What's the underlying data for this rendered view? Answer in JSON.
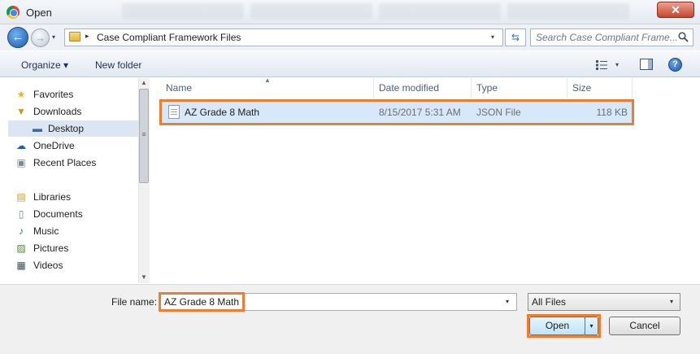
{
  "window": {
    "title": "Open",
    "background_tabs": [
      "",
      "",
      "",
      "",
      ""
    ]
  },
  "title_bar": {
    "close_glyph": "✕"
  },
  "address_bar": {
    "back_glyph": "←",
    "forward_glyph": "→",
    "dropdown_glyph": "▾",
    "breadcrumb_separator": "▸",
    "breadcrumb": "Case Compliant Framework Files",
    "refresh_glyph": "⇆",
    "search_placeholder": "Search Case Compliant Frame..."
  },
  "toolbar": {
    "organize_label": "Organize ▾",
    "new_folder_label": "New folder",
    "views_dropdown_glyph": "▾",
    "help_glyph": "?"
  },
  "navigation": {
    "items": [
      {
        "label": "Favorites",
        "icon": "star-icon",
        "glyph": "★",
        "color": "#f0b21a"
      },
      {
        "label": "Downloads",
        "icon": "downloads-folder-icon",
        "glyph": "▼",
        "color": "#c99a2e"
      },
      {
        "label": "Desktop",
        "icon": "desktop-icon",
        "glyph": "▬",
        "color": "#3a6aa8"
      },
      {
        "label": "OneDrive",
        "icon": "cloud-icon",
        "glyph": "☁",
        "color": "#1a5fb4"
      },
      {
        "label": "Recent Places",
        "icon": "recent-places-icon",
        "glyph": "▣",
        "color": "#7d8897"
      },
      {
        "label": "Libraries",
        "icon": "libraries-icon",
        "glyph": "▤",
        "color": "#c99a2e"
      },
      {
        "label": "Documents",
        "icon": "documents-icon",
        "glyph": "▯",
        "color": "#6f7f93"
      },
      {
        "label": "Music",
        "icon": "music-icon",
        "glyph": "♪",
        "color": "#2e6db4"
      },
      {
        "label": "Pictures",
        "icon": "pictures-icon",
        "glyph": "▨",
        "color": "#4f8a3b"
      },
      {
        "label": "Videos",
        "icon": "videos-icon",
        "glyph": "▦",
        "color": "#3a4a5c"
      }
    ],
    "scroll_up_glyph": "▲",
    "scroll_down_glyph": "▼"
  },
  "file_list": {
    "columns": [
      "Name",
      "Date modified",
      "Type",
      "Size"
    ],
    "sort_glyph": "▲",
    "rows": [
      {
        "name": "AZ Grade 8 Math",
        "date_modified": "8/15/2017 5:31 AM",
        "type": "JSON File",
        "size": "118 KB"
      }
    ]
  },
  "footer": {
    "file_name_label": "File name:",
    "file_name_value": "AZ Grade 8 Math",
    "file_name_dropdown_glyph": "▾",
    "file_type_value": "All Files",
    "file_type_dropdown_glyph": "▾",
    "open_label": "Open",
    "open_split_glyph": "▾",
    "cancel_label": "Cancel"
  },
  "colors": {
    "highlight": "#ed7d31",
    "selection": "#d7e8fb"
  }
}
